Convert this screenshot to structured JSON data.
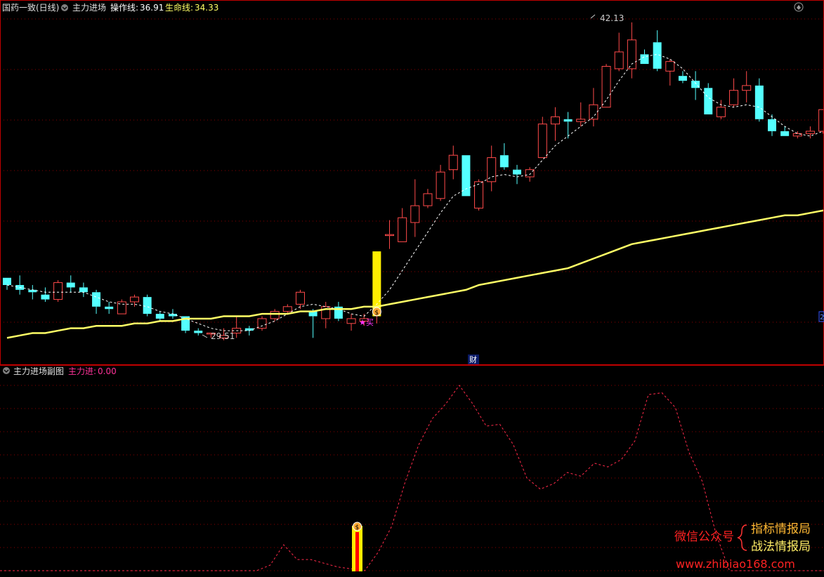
{
  "main_panel": {
    "stock_name": "国药一致(日线)",
    "indicator_name": "主力进场",
    "op_line_label": "操作线:",
    "op_line_value": "36.91",
    "life_line_label": "生命线:",
    "life_line_value": "34.33",
    "high_label": "42.13",
    "low_label": "29.51",
    "buy_label": "买",
    "cai_label": "财",
    "edge_tag": "2"
  },
  "sub_panel": {
    "title": "主力进场副图",
    "value_label": "主力进:",
    "value": "0.00"
  },
  "watermark": {
    "left": "微信公众号",
    "line1": "指标情报局",
    "line2": "战法情报局",
    "url": "www.zhibiao168.com"
  },
  "colors": {
    "up": "#ff4a4a",
    "down": "#54ffff",
    "dashed_ma": "#ffffff",
    "life_line": "#ffff66",
    "sub_line": "#ff2a4a",
    "grid": "#8b0000"
  },
  "chart_data": [
    {
      "type": "candlestick",
      "ohlc": [
        [
          31.5,
          31.5,
          31.0,
          31.2
        ],
        [
          31.2,
          31.6,
          30.8,
          31.0
        ],
        [
          31.0,
          31.2,
          30.6,
          30.9
        ],
        [
          30.8,
          31.1,
          30.5,
          30.6
        ],
        [
          30.6,
          31.4,
          30.5,
          31.3
        ],
        [
          31.3,
          31.6,
          30.9,
          31.1
        ],
        [
          31.1,
          31.3,
          30.7,
          30.9
        ],
        [
          30.9,
          31.0,
          30.0,
          30.3
        ],
        [
          30.3,
          30.5,
          30.0,
          30.2
        ],
        [
          30.0,
          30.6,
          30.0,
          30.5
        ],
        [
          30.5,
          30.8,
          30.3,
          30.7
        ],
        [
          30.7,
          30.8,
          29.9,
          30.0
        ],
        [
          30.0,
          30.1,
          29.7,
          29.8
        ],
        [
          30.0,
          30.2,
          29.8,
          29.9
        ],
        [
          29.9,
          29.9,
          29.2,
          29.3
        ],
        [
          29.3,
          29.4,
          29.1,
          29.2
        ],
        [
          29.2,
          29.2,
          29.0,
          29.2
        ],
        [
          29.0,
          29.4,
          28.9,
          29.1
        ],
        [
          29.2,
          29.9,
          29.0,
          29.4
        ],
        [
          29.4,
          29.5,
          29.1,
          29.3
        ],
        [
          29.4,
          29.9,
          29.3,
          29.8
        ],
        [
          29.8,
          30.2,
          29.7,
          30.1
        ],
        [
          30.1,
          30.4,
          30.0,
          30.3
        ],
        [
          30.4,
          31.0,
          30.2,
          30.9
        ],
        [
          30.1,
          30.2,
          29.0,
          29.9
        ],
        [
          29.8,
          30.5,
          29.4,
          30.3
        ],
        [
          30.3,
          30.5,
          29.7,
          29.8
        ],
        [
          29.6,
          30.0,
          29.3,
          29.8
        ],
        [
          29.7,
          30.0,
          29.5,
          29.8
        ],
        [
          29.9,
          32.6,
          29.6,
          32.6
        ],
        [
          33.3,
          33.9,
          32.7,
          33.3
        ],
        [
          33.0,
          34.4,
          33.0,
          34.0
        ],
        [
          33.8,
          35.6,
          33.2,
          34.5
        ],
        [
          34.5,
          35.2,
          34.4,
          35.0
        ],
        [
          34.8,
          36.2,
          34.7,
          35.9
        ],
        [
          36.0,
          37.0,
          35.6,
          36.6
        ],
        [
          36.6,
          36.6,
          34.9,
          34.9
        ],
        [
          34.4,
          35.6,
          34.3,
          35.5
        ],
        [
          35.5,
          37.0,
          35.1,
          36.5
        ],
        [
          36.6,
          37.1,
          36.0,
          36.1
        ],
        [
          36.0,
          36.2,
          35.4,
          35.8
        ],
        [
          35.7,
          36.1,
          35.5,
          36.0
        ],
        [
          36.5,
          38.2,
          36.5,
          37.9
        ],
        [
          37.9,
          38.6,
          37.2,
          38.2
        ],
        [
          38.1,
          38.4,
          37.3,
          38.0
        ],
        [
          38.0,
          38.8,
          37.8,
          38.1
        ],
        [
          38.1,
          39.4,
          37.8,
          38.7
        ],
        [
          38.6,
          40.4,
          38.6,
          40.3
        ],
        [
          40.2,
          41.7,
          40.1,
          40.9
        ],
        [
          40.2,
          42.13,
          39.8,
          41.4
        ],
        [
          40.8,
          41.0,
          40.4,
          40.4
        ],
        [
          41.3,
          41.8,
          40.1,
          40.2
        ],
        [
          40.1,
          40.6,
          39.5,
          40.5
        ],
        [
          39.9,
          40.1,
          39.6,
          39.7
        ],
        [
          39.7,
          40.1,
          38.9,
          39.4
        ],
        [
          39.4,
          39.6,
          38.3,
          38.3
        ],
        [
          38.2,
          38.9,
          38.1,
          38.6
        ],
        [
          38.7,
          39.8,
          38.6,
          39.3
        ],
        [
          39.3,
          40.1,
          38.8,
          39.5
        ],
        [
          39.5,
          39.8,
          38.0,
          38.1
        ],
        [
          38.1,
          38.3,
          37.4,
          37.6
        ],
        [
          37.6,
          37.8,
          37.4,
          37.4
        ],
        [
          37.4,
          37.6,
          37.3,
          37.5
        ],
        [
          37.5,
          37.8,
          37.3,
          37.6
        ],
        [
          37.6,
          38.4,
          37.5,
          38.5
        ],
        [
          38.5,
          39.3,
          38.0,
          38.4
        ],
        [
          38.3,
          38.7,
          37.7,
          38.6
        ]
      ],
      "operation_line": [
        31.2,
        31.1,
        31.0,
        30.9,
        30.9,
        30.9,
        30.9,
        30.7,
        30.5,
        30.4,
        30.4,
        30.3,
        30.1,
        30.0,
        29.8,
        29.6,
        29.4,
        29.3,
        29.3,
        29.3,
        29.5,
        29.7,
        30.0,
        30.3,
        30.4,
        30.3,
        30.2,
        30.0,
        29.9,
        30.4,
        31.0,
        31.8,
        32.6,
        33.4,
        34.2,
        34.9,
        35.2,
        35.4,
        35.7,
        35.8,
        35.7,
        35.8,
        36.4,
        37.0,
        37.4,
        37.8,
        38.2,
        38.9,
        39.7,
        40.4,
        40.7,
        40.8,
        40.6,
        40.2,
        39.6,
        39.0,
        38.7,
        38.6,
        38.7,
        38.6,
        38.2,
        37.8,
        37.5,
        37.4,
        37.6,
        38.0,
        38.6
      ],
      "life_line": [
        29.0,
        29.1,
        29.2,
        29.2,
        29.3,
        29.4,
        29.4,
        29.5,
        29.5,
        29.5,
        29.6,
        29.6,
        29.7,
        29.7,
        29.8,
        29.8,
        29.8,
        29.9,
        29.9,
        29.9,
        30.0,
        30.0,
        30.0,
        30.1,
        30.1,
        30.2,
        30.2,
        30.2,
        30.3,
        30.3,
        30.4,
        30.5,
        30.6,
        30.7,
        30.8,
        30.9,
        31.0,
        31.2,
        31.3,
        31.4,
        31.5,
        31.6,
        31.7,
        31.8,
        31.9,
        32.1,
        32.3,
        32.5,
        32.7,
        32.9,
        33.0,
        33.1,
        33.2,
        33.3,
        33.4,
        33.5,
        33.6,
        33.7,
        33.8,
        33.9,
        34.0,
        34.1,
        34.1,
        34.2,
        34.3,
        34.3,
        34.4
      ],
      "price_high": 42.13,
      "price_low": 29.51,
      "buy_signal_index": 29
    },
    {
      "type": "line",
      "series_name": "主力进",
      "values": [
        0,
        0,
        0,
        0,
        0,
        0,
        0,
        0,
        0,
        0,
        0,
        0,
        0,
        0,
        0,
        0,
        0,
        0,
        0,
        0,
        3,
        14,
        6,
        6,
        4,
        2,
        1,
        0,
        10,
        24,
        48,
        68,
        82,
        90,
        100,
        90,
        78,
        79,
        68,
        50,
        44,
        47,
        53,
        51,
        58,
        56,
        60,
        70,
        95,
        96,
        88,
        64,
        48,
        20,
        0,
        0,
        0,
        0,
        0,
        0,
        0,
        0
      ],
      "ylim": [
        0,
        100
      ],
      "signal_index": 27
    }
  ]
}
